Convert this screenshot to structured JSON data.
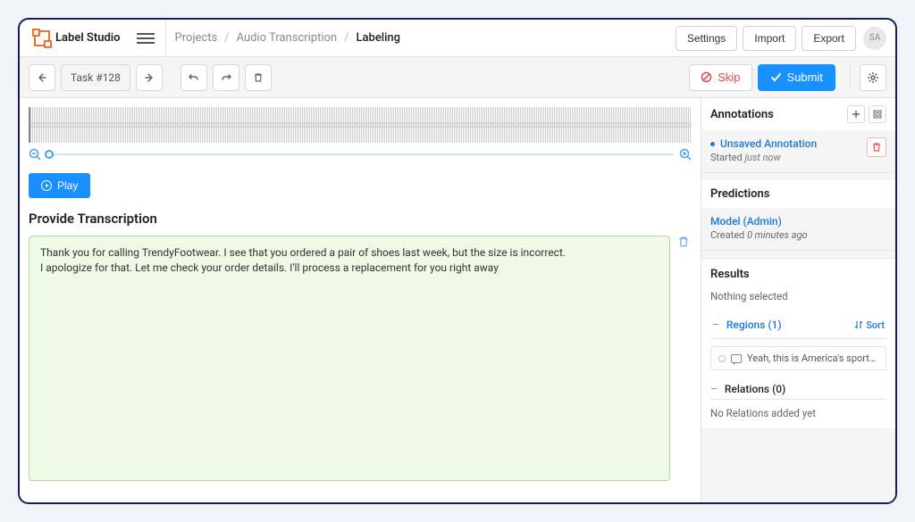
{
  "app": {
    "name": "Label Studio",
    "avatar": "SA"
  },
  "breadcrumb": {
    "item1": "Projects",
    "item2": "Audio Transcription",
    "item3": "Labeling"
  },
  "topButtons": {
    "settings": "Settings",
    "import": "Import",
    "export": "Export"
  },
  "toolbar": {
    "task": "Task #128",
    "skip": "Skip",
    "submit": "Submit"
  },
  "main": {
    "play": "Play",
    "section": "Provide Transcription",
    "transcription": "Thank you for calling TrendyFootwear. I see that you ordered a pair of shoes last week, but the size is incorrect.\nI apologize for that. Let me check your order details. I'll process a replacement for you right away"
  },
  "annotations": {
    "header": "Annotations",
    "title": "Unsaved Annotation",
    "startedLabel": "Started",
    "startedValue": "just now"
  },
  "predictions": {
    "header": "Predictions",
    "title": "Model (Admin)",
    "createdLabel": "Created",
    "createdValue": "0 minutes ago"
  },
  "results": {
    "header": "Results",
    "nothing": "Nothing selected",
    "regionsLabel": "Regions (1)",
    "sort": "Sort",
    "regionText": "Yeah, this is America's sports talk s...",
    "relationsLabel": "Relations (0)",
    "noRelations": "No Relations added yet"
  }
}
